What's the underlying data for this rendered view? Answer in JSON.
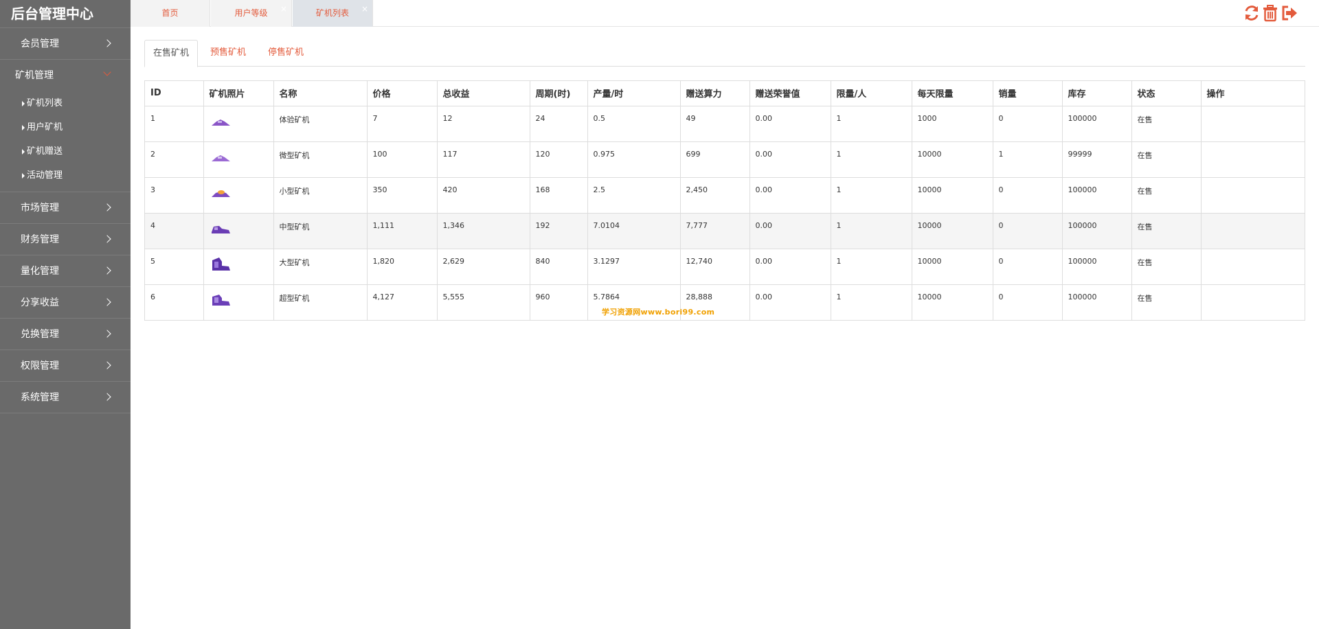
{
  "app": {
    "title": "后台管理中心"
  },
  "sidebar": {
    "items": [
      {
        "label": "会员管理",
        "open": false
      },
      {
        "label": "矿机管理",
        "open": true,
        "children": [
          "矿机列表",
          "用户矿机",
          "矿机赠送",
          "活动管理"
        ]
      },
      {
        "label": "市场管理",
        "open": false
      },
      {
        "label": "财务管理",
        "open": false
      },
      {
        "label": "量化管理",
        "open": false
      },
      {
        "label": "分享收益",
        "open": false
      },
      {
        "label": "兑换管理",
        "open": false
      },
      {
        "label": "权限管理",
        "open": false
      },
      {
        "label": "系统管理",
        "open": false
      }
    ]
  },
  "topbar": {
    "tabs": [
      {
        "label": "首页",
        "close": ""
      },
      {
        "label": "用户等级",
        "close": "×"
      },
      {
        "label": "矿机列表",
        "close": "×"
      }
    ],
    "tools": [
      {
        "icon": "refresh-icon"
      },
      {
        "icon": "trash-icon"
      },
      {
        "icon": "logout-icon"
      }
    ],
    "accent_color": "#e35b3c"
  },
  "subtabs": [
    "在售矿机",
    "预售矿机",
    "停售矿机"
  ],
  "table": {
    "headers": [
      "ID",
      "矿机照片",
      "名称",
      "价格",
      "总收益",
      "周期(时)",
      "产量/时",
      "赠送算力",
      "赠送荣誉值",
      "限量/人",
      "每天限量",
      "销量",
      "库存",
      "状态",
      "操作"
    ],
    "rows": [
      {
        "id": "1",
        "name": "体验矿机",
        "price": "7",
        "total": "12",
        "cycle": "24",
        "rate": "0.5",
        "power": "49",
        "honor": "0.00",
        "limit": "1",
        "daily": "1000",
        "sold": "0",
        "stock": "100000",
        "status": "在售",
        "action": ""
      },
      {
        "id": "2",
        "name": "微型矿机",
        "price": "100",
        "total": "117",
        "cycle": "120",
        "rate": "0.975",
        "power": "699",
        "honor": "0.00",
        "limit": "1",
        "daily": "10000",
        "sold": "1",
        "stock": "99999",
        "status": "在售",
        "action": ""
      },
      {
        "id": "3",
        "name": "小型矿机",
        "price": "350",
        "total": "420",
        "cycle": "168",
        "rate": "2.5",
        "power": "2,450",
        "honor": "0.00",
        "limit": "1",
        "daily": "10000",
        "sold": "0",
        "stock": "100000",
        "status": "在售",
        "action": ""
      },
      {
        "id": "4",
        "name": "中型矿机",
        "price": "1,111",
        "total": "1,346",
        "cycle": "192",
        "rate": "7.0104",
        "power": "7,777",
        "honor": "0.00",
        "limit": "1",
        "daily": "10000",
        "sold": "0",
        "stock": "100000",
        "status": "在售",
        "action": ""
      },
      {
        "id": "5",
        "name": "大型矿机",
        "price": "1,820",
        "total": "2,629",
        "cycle": "840",
        "rate": "3.1297",
        "power": "12,740",
        "honor": "0.00",
        "limit": "1",
        "daily": "10000",
        "sold": "0",
        "stock": "100000",
        "status": "在售",
        "action": ""
      },
      {
        "id": "6",
        "name": "超型矿机",
        "price": "4,127",
        "total": "5,555",
        "cycle": "960",
        "rate": "5.7864",
        "power": "28,888",
        "honor": "0.00",
        "limit": "1",
        "daily": "10000",
        "sold": "0",
        "stock": "100000",
        "status": "在售",
        "action": ""
      }
    ]
  },
  "watermark": "学习资源网www.bori99.com"
}
